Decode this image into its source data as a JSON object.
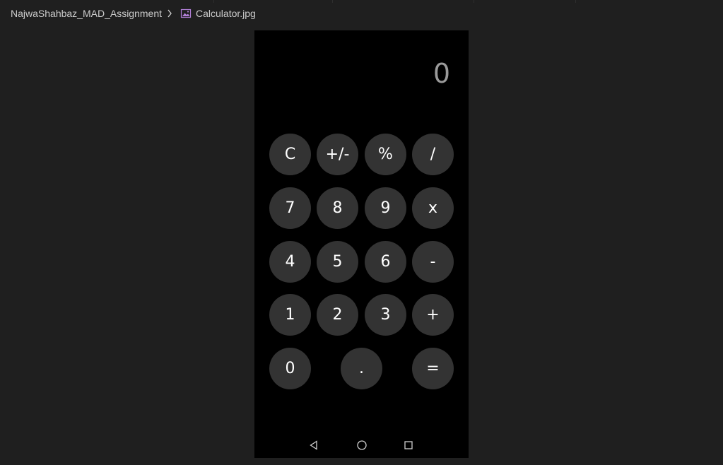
{
  "breadcrumb": {
    "folder": "NajwaShahbaz_MAD_Assignment",
    "file": "Calculator.jpg"
  },
  "icons": {
    "separator": "chevron-right-icon",
    "file": "image-file-icon",
    "nav_back": "triangle-back-icon",
    "nav_home": "circle-home-icon",
    "nav_recent": "square-recents-icon"
  },
  "colors": {
    "editor_bg": "#1f1f1f",
    "phone_bg": "#000000",
    "button_bg": "#333333",
    "button_text": "#ffffff",
    "display_text": "#9a9a9a",
    "file_icon": "#b180d7"
  },
  "calculator": {
    "display": "0",
    "buttons": {
      "clear": "C",
      "sign": "+/-",
      "percent": "%",
      "divide": "/",
      "seven": "7",
      "eight": "8",
      "nine": "9",
      "multiply": "x",
      "four": "4",
      "five": "5",
      "six": "6",
      "subtract": "-",
      "one": "1",
      "two": "2",
      "three": "3",
      "add": "+",
      "zero": "0",
      "decimal": ".",
      "equals": "="
    }
  }
}
